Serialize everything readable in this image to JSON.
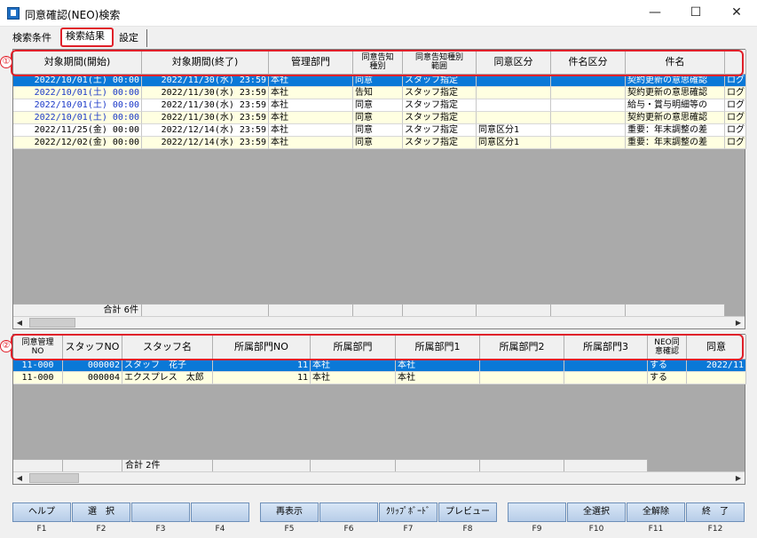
{
  "window": {
    "title": "同意確認(NEO)検索",
    "minimize": "—",
    "maximize": "☐",
    "close": "✕"
  },
  "tabs": [
    {
      "label": "検索条件"
    },
    {
      "label": "検索結果"
    },
    {
      "label": "設定"
    }
  ],
  "markers": {
    "grid1": "①",
    "grid2": "②"
  },
  "grid1": {
    "headers": [
      "対象期間(開始)",
      "対象期間(終了)",
      "管理部門",
      "同意告知\n種別",
      "同意告知種別\n範囲",
      "同意区分",
      "件名区分",
      "件名",
      ""
    ],
    "rows": [
      [
        "2022/10/01(土) 00:00",
        "2022/11/30(水) 23:59",
        "本社",
        "同意",
        "スタッフ指定",
        "",
        "",
        "契約更新の意思確認",
        "ログ"
      ],
      [
        "2022/10/01(土) 00:00",
        "2022/11/30(水) 23:59",
        "本社",
        "告知",
        "スタッフ指定",
        "",
        "",
        "契約更新の意思確認",
        "ログ"
      ],
      [
        "2022/10/01(土) 00:00",
        "2022/11/30(水) 23:59",
        "本社",
        "同意",
        "スタッフ指定",
        "",
        "",
        "給与・賞与明細等の",
        "ログ"
      ],
      [
        "2022/10/01(土) 00:00",
        "2022/11/30(水) 23:59",
        "本社",
        "同意",
        "スタッフ指定",
        "",
        "",
        "契約更新の意思確認",
        "ログ"
      ],
      [
        "2022/11/25(金) 00:00",
        "2022/12/14(水) 23:59",
        "本社",
        "同意",
        "スタッフ指定",
        "同意区分1",
        "",
        "重要：年末調整の差",
        "ログ"
      ],
      [
        "2022/12/02(金) 00:00",
        "2022/12/14(水) 23:59",
        "本社",
        "同意",
        "スタッフ指定",
        "同意区分1",
        "",
        "重要：年末調整の差",
        "ログ"
      ]
    ],
    "total": "合計 6件"
  },
  "grid2": {
    "headers": [
      "同意管理\nNO",
      "スタッフNO",
      "スタッフ名",
      "所属部門NO",
      "所属部門",
      "所属部門1",
      "所属部門2",
      "所属部門3",
      "NEO同\n意確認",
      "同意"
    ],
    "rows": [
      [
        "11-000",
        "000002",
        "スタッフ　花子",
        "11",
        "本社",
        "本社",
        "",
        "",
        "する",
        "2022/11"
      ],
      [
        "11-000",
        "000004",
        "エクスプレス　太郎",
        "11",
        "本社",
        "本社",
        "",
        "",
        "する",
        ""
      ]
    ],
    "total": "合計 2件"
  },
  "function_keys": [
    {
      "label": "ヘルプ",
      "key": "F1"
    },
    {
      "label": "選　択",
      "key": "F2"
    },
    {
      "label": "",
      "key": "F3"
    },
    {
      "label": "",
      "key": "F4"
    },
    {
      "label": "再表示",
      "key": "F5"
    },
    {
      "label": "",
      "key": "F6"
    },
    {
      "label": "ｸﾘｯﾌﾟﾎﾞｰﾄﾞ",
      "key": "F7"
    },
    {
      "label": "プレビュー",
      "key": "F8"
    },
    {
      "label": "",
      "key": "F9"
    },
    {
      "label": "全選択",
      "key": "F10"
    },
    {
      "label": "全解除",
      "key": "F11"
    },
    {
      "label": "終　了",
      "key": "F12"
    }
  ]
}
